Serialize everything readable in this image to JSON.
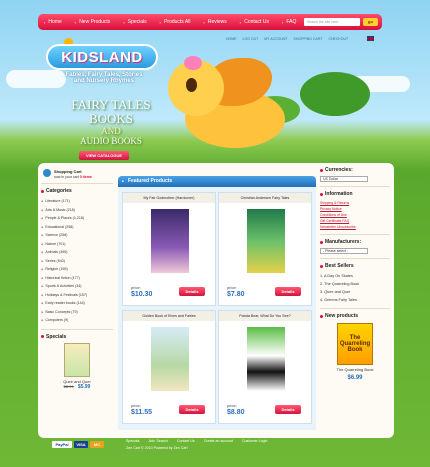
{
  "topnav": {
    "items": [
      "Home",
      "New Products",
      "Specials",
      "Products All",
      "Reviews",
      "Contact Us",
      "FAQ"
    ],
    "search_placeholder": "Search the site here",
    "search_button": "go"
  },
  "account_links": [
    "HOME",
    "LOG OUT",
    "MY ACCOUNT",
    "SHOPPING CART",
    "CHECKOUT"
  ],
  "hero": {
    "logo": "KIDSLAND",
    "tagline_line1": "Fables, Fairy Tales, Stories",
    "tagline_line2": "and Nursery Rhymes",
    "title_line1": "FAIRY TALES",
    "title_line2": "BOOKS",
    "title_line3": "AND",
    "title_line4": "AUDIO BOOKS",
    "catalogue_button": "VIEW CATALOGUE"
  },
  "cart": {
    "title": "Shopping Cart",
    "status_prefix": "now in your cart",
    "status_count": "0 items"
  },
  "categories": {
    "title": "Categories",
    "items": [
      "Literature (171)",
      "Arts & Music (218)",
      "People & Places (1,218)",
      "Educational (258)",
      "Science (258)",
      "Nature (701)",
      "Animals (495)",
      "Series (543)",
      "Religion (165)",
      "Historical fiction (177)",
      "Sports & Activities (34)",
      "Holidays & Festivals (157)",
      "Early reader books (144)",
      "Basic Concepts (79)",
      "Computers (9)"
    ]
  },
  "specials": {
    "title": "Specials",
    "book": "Quee and Quer",
    "old_price": "$8.99",
    "new_price": "$5.99"
  },
  "center": {
    "heading": "Featured Products",
    "products": [
      {
        "title": "My Fair Godmother (Hardcover)",
        "price_label": "price:",
        "price": "$10.30",
        "button": "Details"
      },
      {
        "title": "Christian Andersen Fairy Tales",
        "price_label": "price:",
        "price": "$7.80",
        "button": "Details"
      },
      {
        "title": "Golden Book of Elves and Fairies",
        "price_label": "price:",
        "price": "$11.55",
        "button": "Details"
      },
      {
        "title": "Panda Bear, What Do You See?",
        "price_label": "price:",
        "price": "$8.80",
        "button": "Details"
      }
    ]
  },
  "right": {
    "currencies_title": "Currencies:",
    "currency_selected": "US Dollar",
    "information_title": "Information",
    "information_links": [
      "Shipping & Returns",
      "Privacy Notice",
      "Conditions of Use",
      "Gift Certificate FAQ",
      "Newsletter Unsubscribe"
    ],
    "manufacturers_title": "Manufacturers:",
    "manufacturer_selected": "- Please select -",
    "bestsellers_title": "Best Sellers",
    "bestsellers": [
      "1.  A Day On Skates",
      "2.  The Quarreling Book",
      "3.  Quee and Quer",
      "4.  Grimms Fairy Tales"
    ],
    "new_products_title": "New products",
    "new_product_cover": "The Quarreling Book",
    "new_product_name": "The Quarreling Book",
    "new_product_price": "$6.99"
  },
  "footer": {
    "links": [
      "Specials",
      "Adv. Search",
      "Contact Us",
      "Create an account",
      "Customer Login"
    ],
    "copyright": "Zen Cart © 2010  Powered by Zen Cart",
    "payment_logos": [
      "PayPal",
      "VISA",
      "MC"
    ]
  },
  "colors": {
    "nav_red": "#d90f3a",
    "featured_blue": "#1f6fb9",
    "price_blue": "#2b6fb7"
  }
}
